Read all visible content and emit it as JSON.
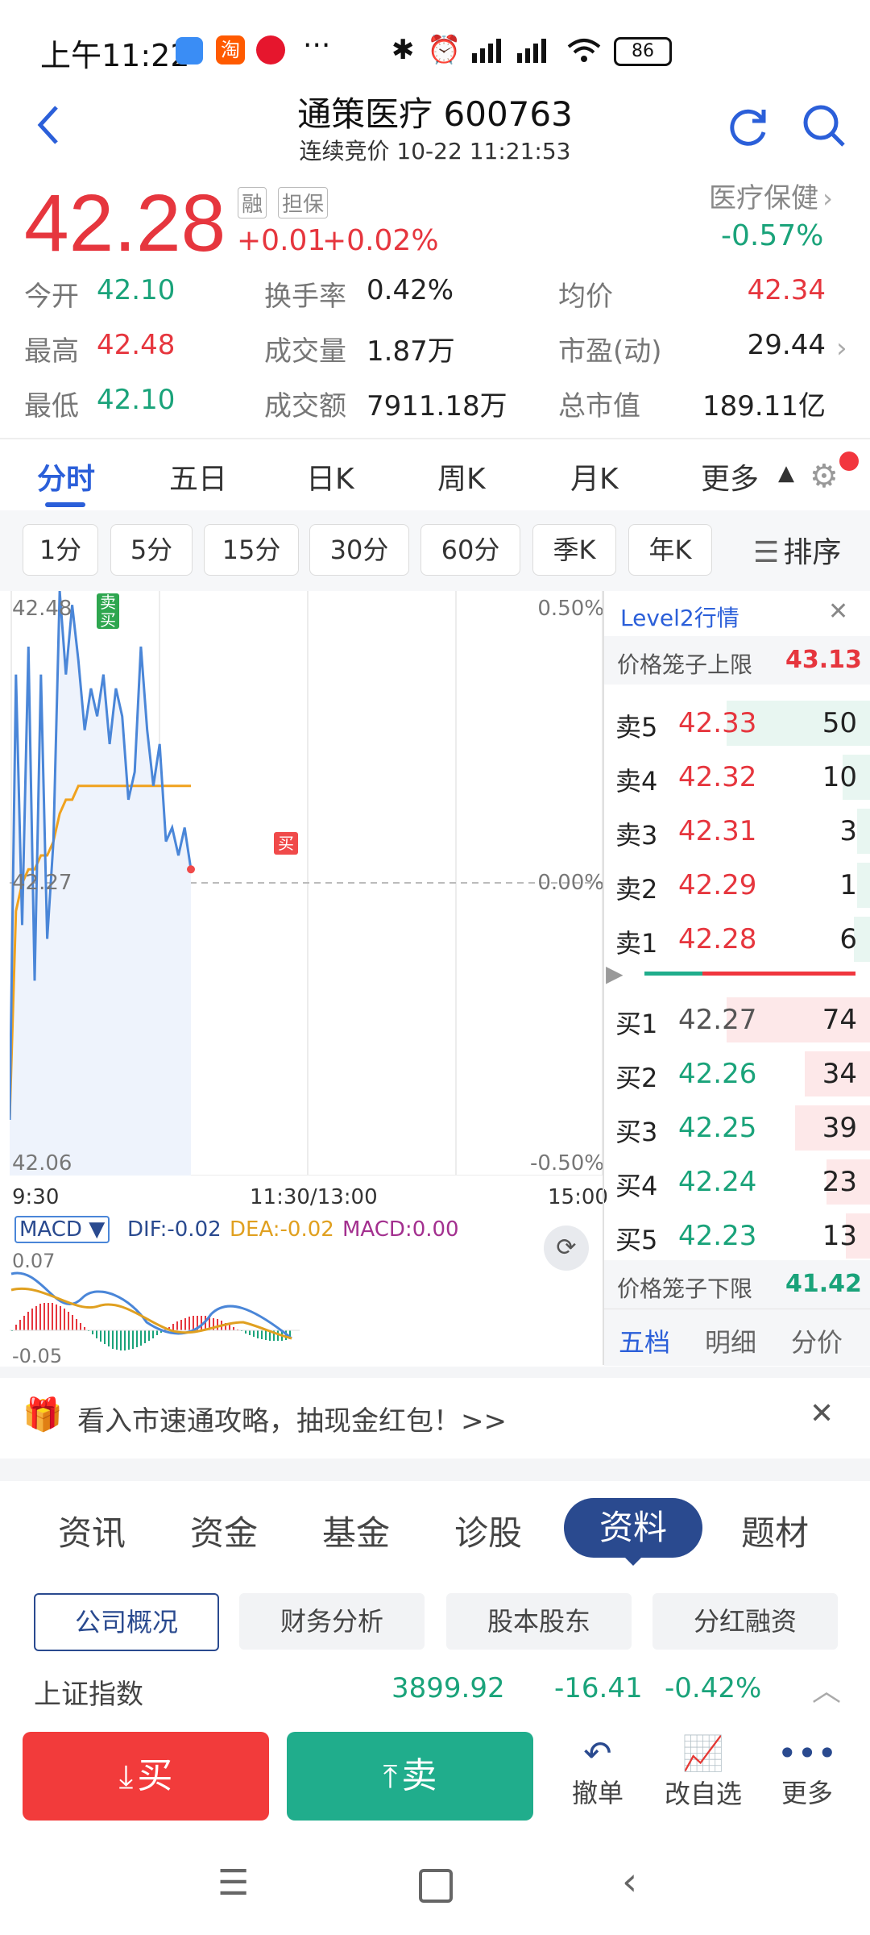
{
  "status": {
    "time": "上午11:22",
    "dots": "···",
    "battery": "86"
  },
  "header": {
    "title": "通策医疗 600763",
    "subtitle": "连续竞价 10-22 11:21:53"
  },
  "quote": {
    "price": "42.28",
    "tag1": "融",
    "tag2": "担保",
    "change": "+0.01",
    "change_pct": "+0.02%",
    "sector": "医疗保健",
    "sector_pct": "-0.57%"
  },
  "stats": {
    "open_label": "今开",
    "open": "42.10",
    "turnover_label": "换手率",
    "turnover": "0.42%",
    "avg_label": "均价",
    "avg": "42.34",
    "high_label": "最高",
    "high": "42.48",
    "vol_label": "成交量",
    "vol": "1.87万",
    "pe_label": "市盈(动)",
    "pe": "29.44",
    "low_label": "最低",
    "low": "42.10",
    "amount_label": "成交额",
    "amount": "7911.18万",
    "mcap_label": "总市值",
    "mcap": "189.11亿"
  },
  "period_tabs": [
    "分时",
    "五日",
    "日K",
    "周K",
    "月K",
    "更多"
  ],
  "intervals": [
    "1分",
    "5分",
    "15分",
    "30分",
    "60分",
    "季K",
    "年K"
  ],
  "sort_label": "排序",
  "chart": {
    "y_top": "42.48",
    "y_mid": "42.27",
    "y_bot": "42.06",
    "pct_top": "0.50%",
    "pct_mid": "0.00%",
    "pct_bot": "-0.50%",
    "x_start": "9:30",
    "x_mid": "11:30/13:00",
    "x_end": "15:00",
    "marker_sell": "卖",
    "marker_buy": "买",
    "marker_buy2": "买"
  },
  "chart_data": {
    "type": "line",
    "title": "",
    "ylim": [
      42.06,
      42.48
    ],
    "series": [
      {
        "name": "price",
        "values": [
          42.1,
          42.42,
          42.24,
          42.44,
          42.2,
          42.42,
          42.23,
          42.3,
          42.48,
          42.42,
          42.47,
          42.43,
          42.38,
          42.41,
          42.39,
          42.42,
          42.37,
          42.41,
          42.39,
          42.33,
          42.35,
          42.44,
          42.38,
          42.34,
          42.37,
          42.3,
          42.31,
          42.29,
          42.31,
          42.28
        ]
      },
      {
        "name": "avg",
        "values": [
          42.1,
          42.25,
          42.27,
          42.28,
          42.28,
          42.29,
          42.29,
          42.3,
          42.32,
          42.33,
          42.33,
          42.34,
          42.34,
          42.34,
          42.34,
          42.34,
          42.34,
          42.34,
          42.34,
          42.34,
          42.34,
          42.34,
          42.34,
          42.34,
          42.34,
          42.34,
          42.34,
          42.34,
          42.34,
          42.34
        ]
      }
    ]
  },
  "macd": {
    "selector": "MACD ▼",
    "dif": "DIF:-0.02",
    "dea": "DEA:-0.02",
    "macd": "MACD:0.00",
    "y_top": "0.07",
    "y_bot": "-0.05"
  },
  "level2": {
    "title": "Level2行情",
    "upper_label": "价格笼子上限",
    "upper": "43.13",
    "asks": [
      {
        "label": "卖5",
        "price": "42.33",
        "vol": "50"
      },
      {
        "label": "卖4",
        "price": "42.32",
        "vol": "10"
      },
      {
        "label": "卖3",
        "price": "42.31",
        "vol": "3"
      },
      {
        "label": "卖2",
        "price": "42.29",
        "vol": "1"
      },
      {
        "label": "卖1",
        "price": "42.28",
        "vol": "6"
      }
    ],
    "bids": [
      {
        "label": "买1",
        "price": "42.27",
        "vol": "74"
      },
      {
        "label": "买2",
        "price": "42.26",
        "vol": "34"
      },
      {
        "label": "买3",
        "price": "42.25",
        "vol": "39"
      },
      {
        "label": "买4",
        "price": "42.24",
        "vol": "23"
      },
      {
        "label": "买5",
        "price": "42.23",
        "vol": "13"
      }
    ],
    "lower_label": "价格笼子下限",
    "lower": "41.42",
    "tabs": [
      "五档",
      "明细",
      "分价"
    ]
  },
  "banner": {
    "text": "看入市速通攻略，抽现金红包！>>"
  },
  "info_tabs": [
    "资讯",
    "资金",
    "基金",
    "诊股",
    "资料",
    "题材"
  ],
  "sub_tabs": [
    "公司概况",
    "财务分析",
    "股本股东",
    "分红融资"
  ],
  "index": {
    "name": "上证指数",
    "value": "3899.92",
    "change": "-16.41",
    "pct": "-0.42%"
  },
  "actions": {
    "buy": "买",
    "sell": "卖",
    "cancel": "撤单",
    "edit": "改自选",
    "more": "更多"
  },
  "colors": {
    "up": "#e6363e",
    "down": "#1aa37a",
    "accent": "#2b5fd9",
    "buy_btn": "#f23b3b",
    "sell_btn": "#20ad8c",
    "navy": "#2a4a8f"
  }
}
